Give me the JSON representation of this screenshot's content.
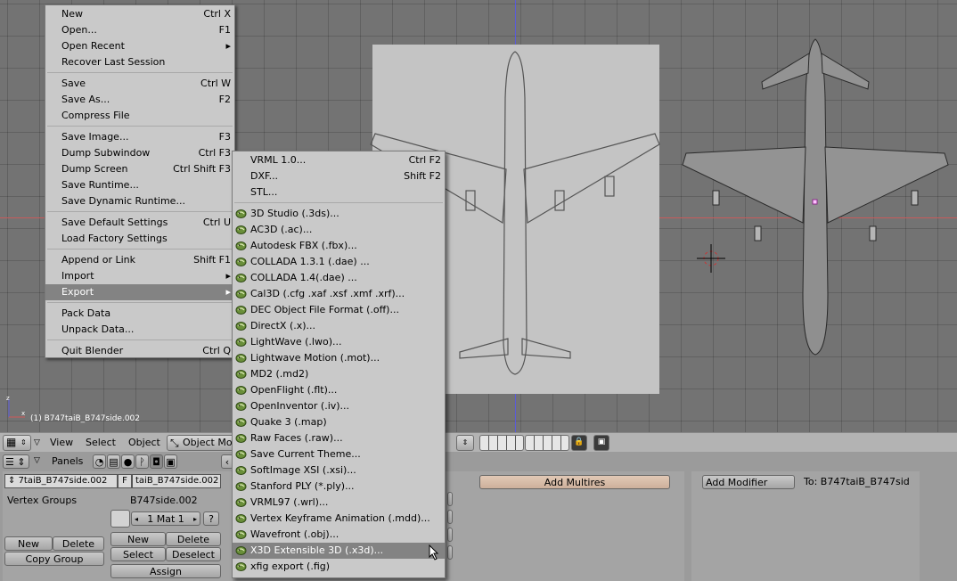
{
  "viewport": {
    "object_label": "(1) B747taiB_B747side.002"
  },
  "header": {
    "view": "View",
    "select": "Select",
    "object": "Object",
    "mode": "Object Mo"
  },
  "buttons": {
    "panels": "Panels",
    "object_name": "7taiB_B747side.002",
    "f_label": "F",
    "mesh_name": "taiB_B747side.002",
    "vertex_groups": "Vertex Groups",
    "mesh_label": "B747side.002",
    "mat_value": "1 Mat 1",
    "question": "?",
    "new": "New",
    "delete": "Delete",
    "copy_group": "Copy Group",
    "mat_new": "New",
    "mat_delete": "Delete",
    "mat_select": "Select",
    "mat_deselect": "Deselect",
    "assign": "Assign",
    "add_multires": "Add Multires",
    "add_modifier": "Add Modifier",
    "to_label": "To: B747taiB_B747sid"
  },
  "file_menu": {
    "items": [
      {
        "label": "New",
        "shortcut": "Ctrl X"
      },
      {
        "label": "Open...",
        "shortcut": "F1"
      },
      {
        "label": "Open Recent",
        "shortcut": "▸"
      },
      {
        "label": "Recover Last Session",
        "shortcut": ""
      },
      {
        "label": "Save",
        "shortcut": "Ctrl W"
      },
      {
        "label": "Save As...",
        "shortcut": "F2"
      },
      {
        "label": "Compress File",
        "shortcut": ""
      },
      {
        "label": "Save Image...",
        "shortcut": "F3"
      },
      {
        "label": "Dump Subwindow",
        "shortcut": "Ctrl F3"
      },
      {
        "label": "Dump Screen",
        "shortcut": "Ctrl Shift F3"
      },
      {
        "label": "Save Runtime...",
        "shortcut": ""
      },
      {
        "label": "Save Dynamic Runtime...",
        "shortcut": ""
      },
      {
        "label": "Save Default Settings",
        "shortcut": "Ctrl U"
      },
      {
        "label": "Load Factory Settings",
        "shortcut": ""
      },
      {
        "label": "Append or Link",
        "shortcut": "Shift F1"
      },
      {
        "label": "Import",
        "shortcut": "▸"
      },
      {
        "label": "Export",
        "shortcut": "▸"
      },
      {
        "label": "Pack Data",
        "shortcut": ""
      },
      {
        "label": "Unpack Data...",
        "shortcut": ""
      },
      {
        "label": "Quit Blender",
        "shortcut": "Ctrl Q"
      }
    ]
  },
  "export_menu": {
    "items": [
      {
        "label": "VRML 1.0...",
        "shortcut": "Ctrl F2"
      },
      {
        "label": "DXF...",
        "shortcut": "Shift F2"
      },
      {
        "label": "STL...",
        "shortcut": ""
      },
      {
        "label": "3D Studio (.3ds)...",
        "shortcut": ""
      },
      {
        "label": "AC3D (.ac)...",
        "shortcut": ""
      },
      {
        "label": "Autodesk FBX (.fbx)...",
        "shortcut": ""
      },
      {
        "label": "COLLADA 1.3.1 (.dae) ...",
        "shortcut": ""
      },
      {
        "label": "COLLADA 1.4(.dae) ...",
        "shortcut": ""
      },
      {
        "label": "Cal3D (.cfg .xaf .xsf .xmf .xrf)...",
        "shortcut": ""
      },
      {
        "label": "DEC Object File Format (.off)...",
        "shortcut": ""
      },
      {
        "label": "DirectX (.x)...",
        "shortcut": ""
      },
      {
        "label": "LightWave (.lwo)...",
        "shortcut": ""
      },
      {
        "label": "Lightwave Motion (.mot)...",
        "shortcut": ""
      },
      {
        "label": "MD2 (.md2)",
        "shortcut": ""
      },
      {
        "label": "OpenFlight (.flt)...",
        "shortcut": ""
      },
      {
        "label": "OpenInventor (.iv)...",
        "shortcut": ""
      },
      {
        "label": "Quake 3 (.map)",
        "shortcut": ""
      },
      {
        "label": "Raw Faces (.raw)...",
        "shortcut": ""
      },
      {
        "label": "Save Current Theme...",
        "shortcut": ""
      },
      {
        "label": "SoftImage XSI (.xsi)...",
        "shortcut": ""
      },
      {
        "label": "Stanford PLY (*.ply)...",
        "shortcut": ""
      },
      {
        "label": "VRML97 (.wrl)...",
        "shortcut": ""
      },
      {
        "label": "Vertex Keyframe Animation (.mdd)...",
        "shortcut": ""
      },
      {
        "label": "Wavefront (.obj)...",
        "shortcut": ""
      },
      {
        "label": "X3D Extensible 3D (.x3d)...",
        "shortcut": ""
      },
      {
        "label": "xfig export (.fig)",
        "shortcut": ""
      }
    ]
  },
  "colors": {
    "menu_bg": "#c9c9c9",
    "highlight": "#838383",
    "viewport_bg": "#737373"
  }
}
